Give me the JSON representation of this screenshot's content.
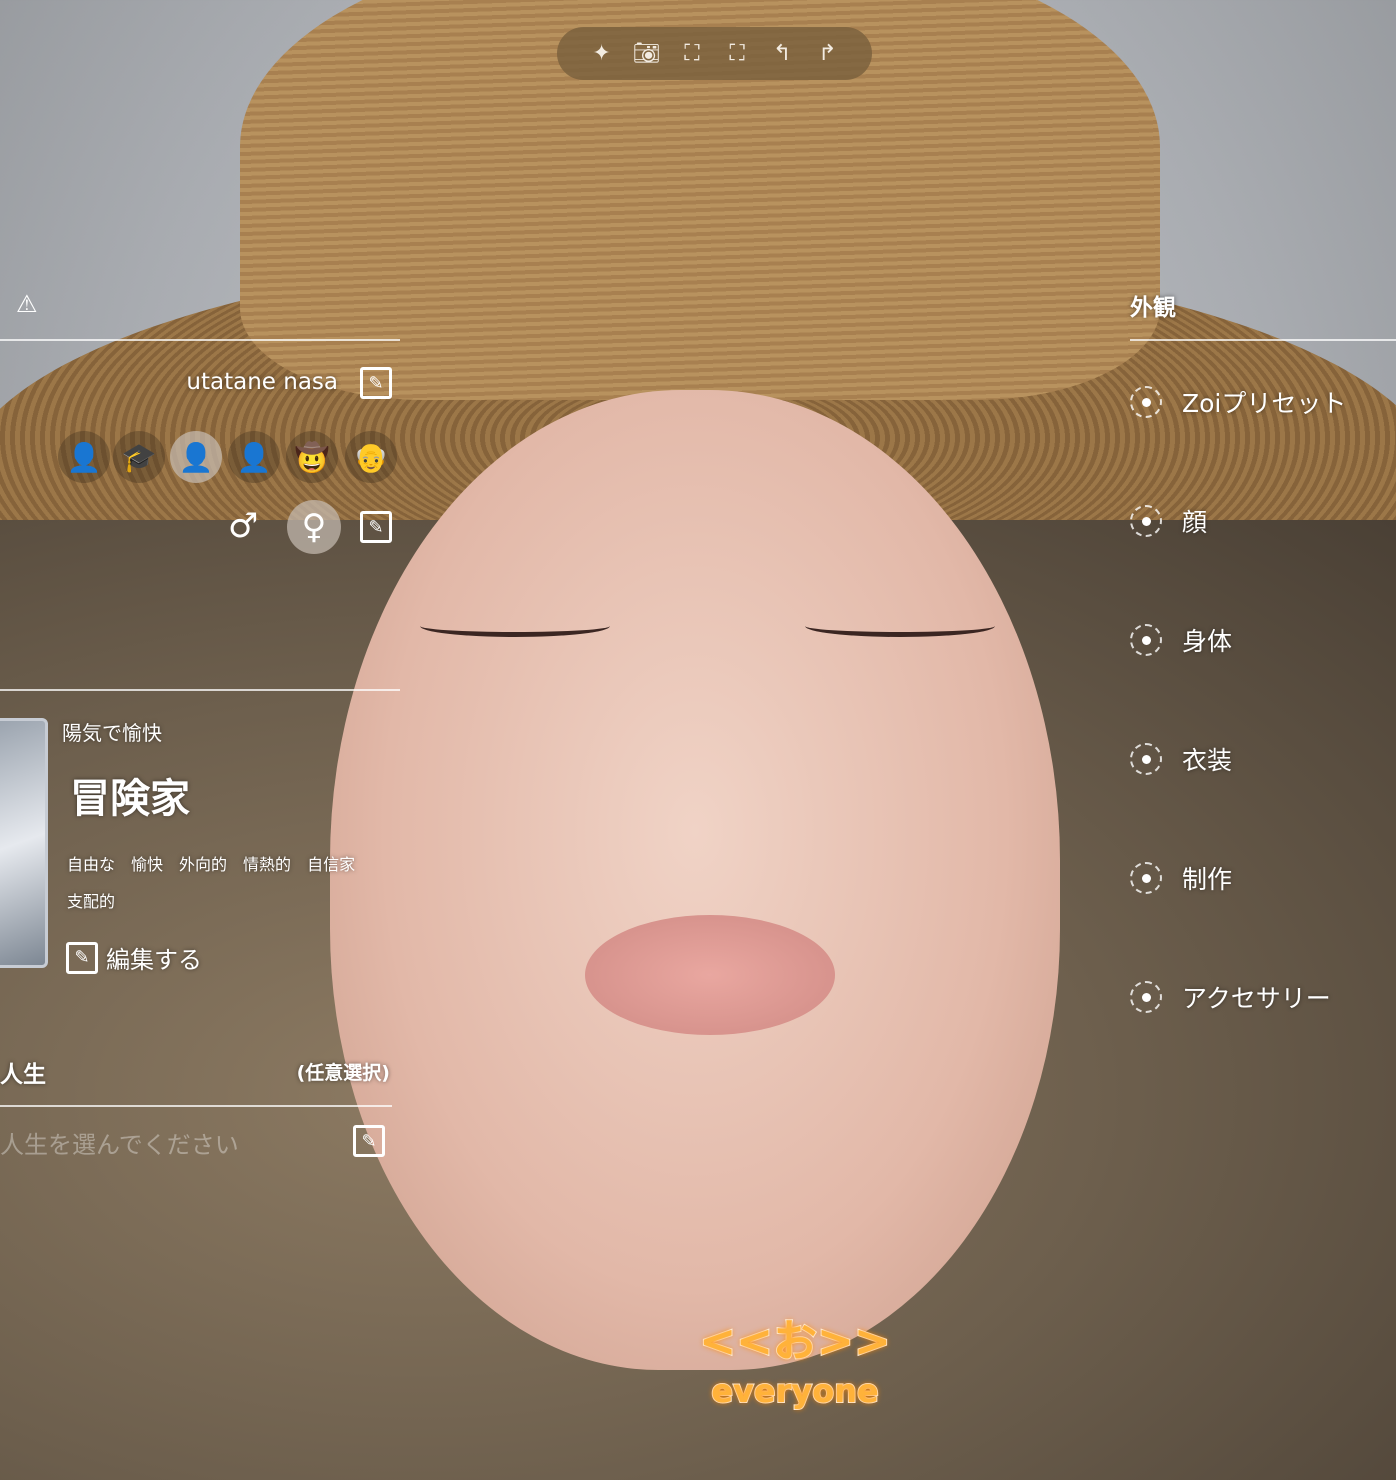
{
  "toolbar": {
    "icons": [
      "sparkle-icon",
      "camera-icon",
      "face-scan-icon",
      "body-scan-icon",
      "undo-icon",
      "redo-icon"
    ]
  },
  "profile": {
    "name": "utatane nasa",
    "gender_male": "♂",
    "gender_female": "♀",
    "selected_gender": "female",
    "age_stages": [
      "baby",
      "student",
      "young-adult",
      "adult",
      "middle-aged",
      "elder"
    ],
    "selected_age_index": 2
  },
  "personality": {
    "subtitle": "陽気で愉快",
    "title": "冒険家",
    "traits": [
      "自由な",
      "愉快",
      "外向的",
      "情熱的",
      "自信家",
      "支配的"
    ],
    "edit_label": "編集する"
  },
  "life": {
    "title": "人生",
    "optional": "(任意選択)",
    "placeholder": "人生を選んでください"
  },
  "appearance": {
    "title": "外観",
    "items": [
      "Zoiプリセット",
      "顔",
      "身体",
      "衣装",
      "制作",
      "アクセサリー"
    ]
  },
  "caption": {
    "line1": "<<お>>",
    "line2": "everyone"
  }
}
